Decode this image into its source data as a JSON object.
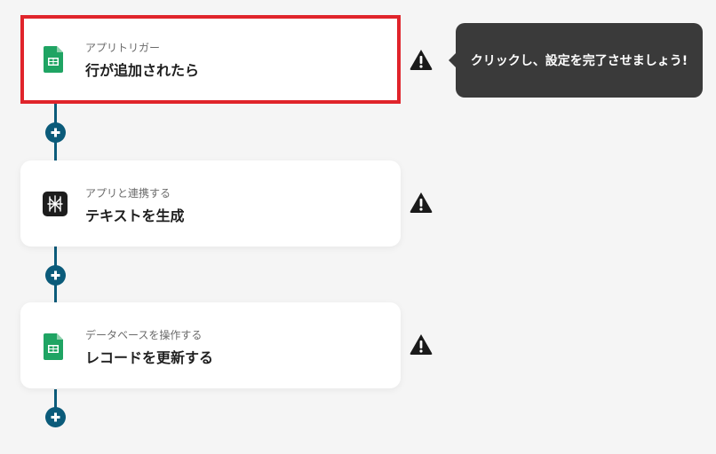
{
  "flow": {
    "steps": [
      {
        "subtitle": "アプリトリガー",
        "title": "行が追加されたら",
        "icon": "google-sheets-icon",
        "selected": true,
        "warning": true
      },
      {
        "subtitle": "アプリと連携する",
        "title": "テキストを生成",
        "icon": "ai-text-icon",
        "selected": false,
        "warning": true
      },
      {
        "subtitle": "データベースを操作する",
        "title": "レコードを更新する",
        "icon": "google-sheets-icon",
        "selected": false,
        "warning": true
      }
    ],
    "add_button_icon": "plus-icon",
    "warning_icon": "warning-icon"
  },
  "tooltip": {
    "text": "クリックし、設定を完了させましょう!"
  },
  "colors": {
    "background": "#f5f5f5",
    "connector": "#0b5b7a",
    "selected_border": "#e0242b",
    "tooltip_bg": "#3a3a3a",
    "sheets_green": "#1fa463"
  }
}
